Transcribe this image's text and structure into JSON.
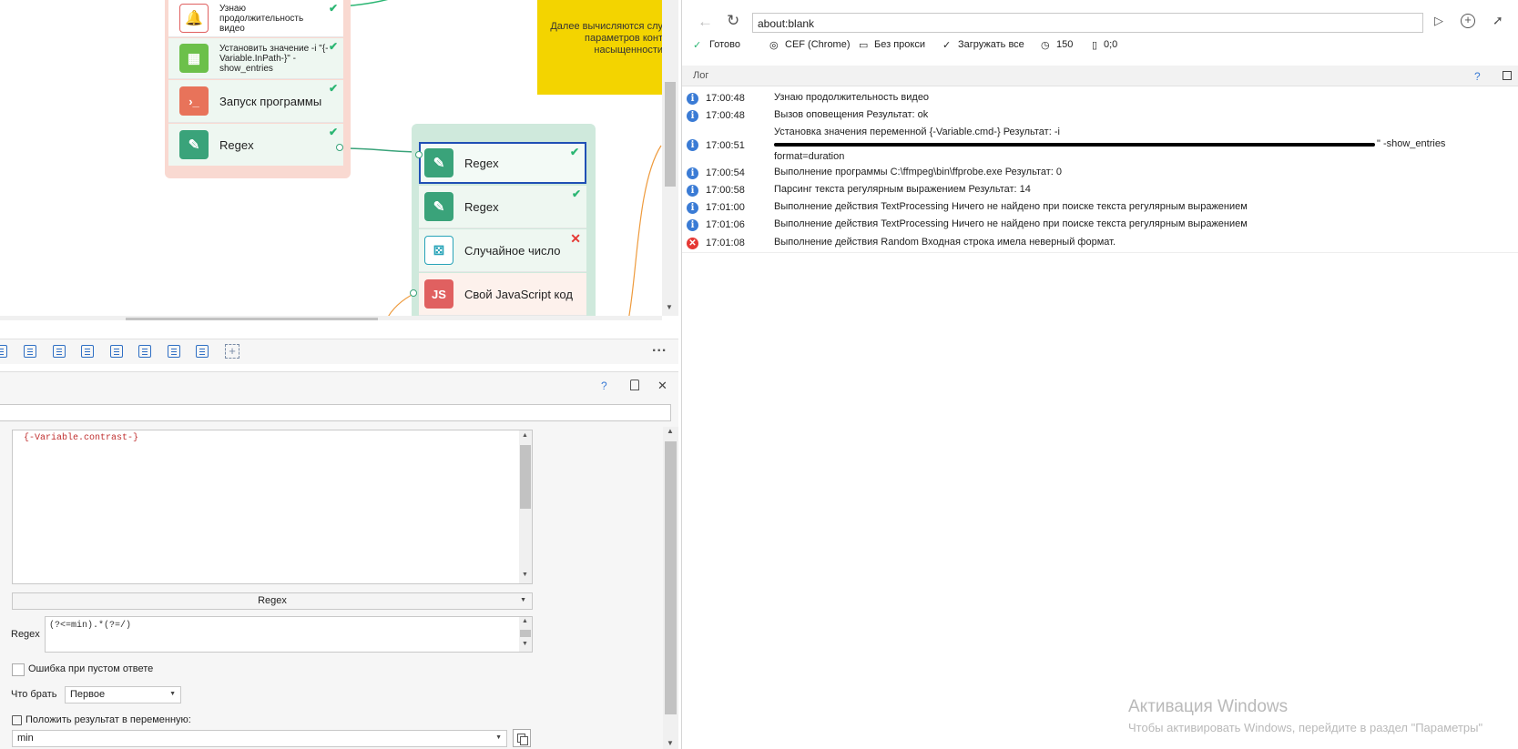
{
  "canvas": {
    "note_text": "Далее вычисляются слу\nпараметров конт\nнасыщенности",
    "group1": {
      "nodes": [
        {
          "label": "Узнаю продолжительность видео",
          "status": "ok"
        },
        {
          "label": "Установить значение -i \"{-Variable.InPath-}\" -show_entries format=durat...",
          "status": "ok"
        },
        {
          "label": "Запуск программы",
          "status": "ok"
        },
        {
          "label": "Regex",
          "status": "ok"
        }
      ]
    },
    "group2": {
      "nodes": [
        {
          "label": "Regex",
          "status": "ok"
        },
        {
          "label": "Regex",
          "status": "ok"
        },
        {
          "label": "Случайное число",
          "status": "error"
        },
        {
          "label": "Свой JavaScript код",
          "status": "none",
          "icon_text": "JS"
        }
      ]
    }
  },
  "toolbar": {
    "more_label": "..."
  },
  "properties": {
    "help_label": "?",
    "pin_label": "📌",
    "close_label": "✕",
    "text_value": "{-Variable.contrast-}",
    "processing_type": "Regex",
    "regex_label": "Regex",
    "regex_value": "(?<=min).*(?=/)",
    "error_on_empty_label": "Ошибка при пустом ответе",
    "take_label": "Что брать",
    "take_value": "Первое",
    "save_to_var_label": "Положить результат в переменную:",
    "var_value": "min"
  },
  "browser": {
    "url": "about:blank",
    "status": {
      "ready": "Готово",
      "engine": "CEF (Chrome)",
      "proxy": "Без прокси",
      "load": "Загружать все",
      "timeout": "150",
      "mouse": "0;0"
    }
  },
  "log": {
    "title": "Лог",
    "help": "?",
    "rows": [
      {
        "time": "17:00:48",
        "type": "info",
        "message": "Узнаю продолжительность видео"
      },
      {
        "time": "17:00:48",
        "type": "info",
        "message": "Вызов оповещения  Результат: ok"
      },
      {
        "time": "17:00:51",
        "type": "info",
        "message": "Установка значения переменной {-Variable.cmd-}  Результат: -i",
        "message2": "\" -show_entries",
        "message3": "format=duration"
      },
      {
        "time": "17:00:54",
        "type": "info",
        "message": "Выполнение программы C:\\ffmpeg\\bin\\ffprobe.exe  Результат: 0"
      },
      {
        "time": "17:00:58",
        "type": "info",
        "message": "Парсинг текста регулярным выражением  Результат: 14"
      },
      {
        "time": "17:01:00",
        "type": "info",
        "message": "Выполнение действия TextProcessing Ничего не найдено при поиске текста регулярным выражением"
      },
      {
        "time": "17:01:06",
        "type": "info",
        "message": "Выполнение действия TextProcessing Ничего не найдено при поиске текста регулярным выражением"
      },
      {
        "time": "17:01:08",
        "type": "error",
        "message": "Выполнение действия Random Входная строка имела неверный формат."
      }
    ]
  },
  "watermark": {
    "title": "Активация Windows",
    "subtitle": "Чтобы активировать Windows, перейдите в раздел \"Параметры\""
  },
  "colors": {
    "group1_bg": "#f9d9d1",
    "group2_bg": "#cfe9dc",
    "note_bg": "#f3d400",
    "accent": "#3a7bd5",
    "ok": "#2bb673",
    "error": "#e53935"
  }
}
